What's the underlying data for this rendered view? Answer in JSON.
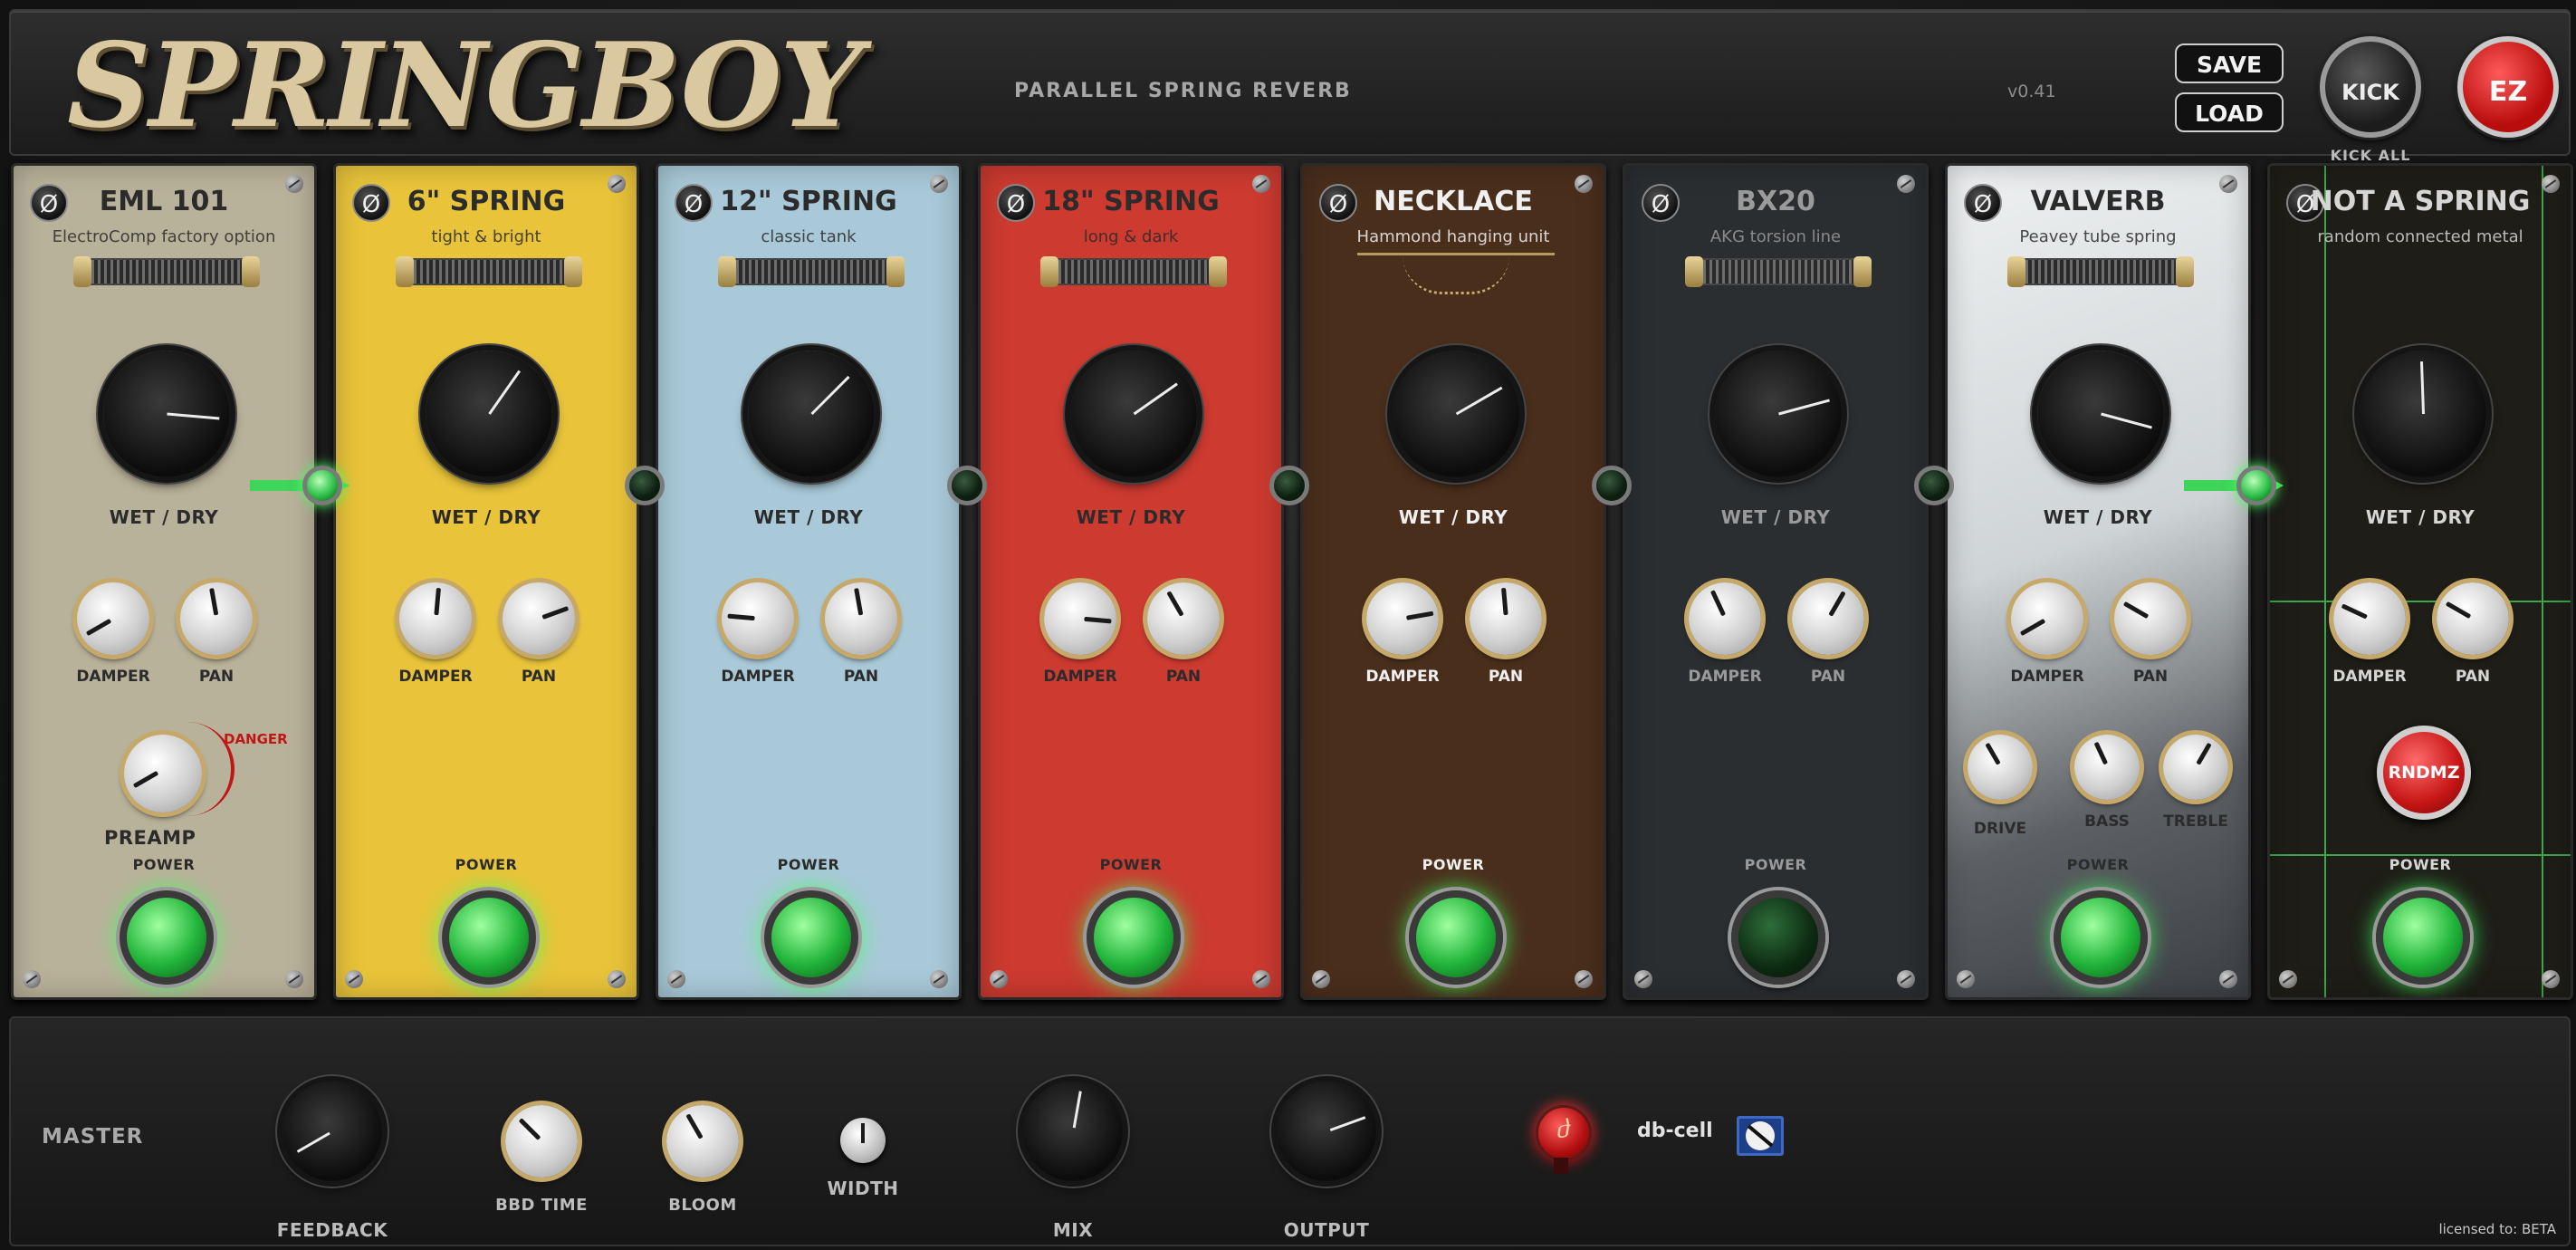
{
  "header": {
    "title": "SPRINGBOY",
    "subtitle": "PARALLEL SPRING REVERB",
    "version": "v0.41",
    "save_label": "SAVE",
    "load_label": "LOAD",
    "kick_label": "KICK",
    "kick_all_label": "KICK ALL",
    "ez_label": "EZ"
  },
  "labels": {
    "phase_symbol": "Ø",
    "wet_dry": "WET / DRY",
    "damper": "DAMPER",
    "pan": "PAN",
    "power": "POWER",
    "preamp": "PREAMP",
    "danger": "DANGER",
    "drive": "DRIVE",
    "bass": "BASS",
    "treble": "TREBLE",
    "rndmz": "RNDMZ"
  },
  "modules": [
    {
      "name": "EML 101",
      "desc": "ElectroComp factory option",
      "power": true,
      "wet_dry_deg": 95,
      "damper_deg": -120,
      "pan_deg": -10,
      "bg": "#b9b29a",
      "text": "#2b2b2b"
    },
    {
      "name": "6\" SPRING",
      "desc": "tight & bright",
      "power": true,
      "wet_dry_deg": 35,
      "damper_deg": 5,
      "pan_deg": 70,
      "bg": "#e9c43a",
      "text": "#2b2b2b"
    },
    {
      "name": "12\" SPRING",
      "desc": "classic tank",
      "power": true,
      "wet_dry_deg": 45,
      "damper_deg": -85,
      "pan_deg": -10,
      "bg": "#a9c9d8",
      "text": "#2b2b2b"
    },
    {
      "name": "18\" SPRING",
      "desc": "long & dark",
      "power": true,
      "wet_dry_deg": 55,
      "damper_deg": 95,
      "pan_deg": -30,
      "bg": "#cc3a30",
      "text": "#2b2b2b"
    },
    {
      "name": "NECKLACE",
      "desc": "Hammond hanging unit",
      "power": true,
      "wet_dry_deg": 60,
      "damper_deg": 80,
      "pan_deg": -5,
      "bg": "#4a2e1c",
      "text": "#f0f0f0"
    },
    {
      "name": "BX20",
      "desc": "AKG torsion line",
      "power": false,
      "wet_dry_deg": 75,
      "damper_deg": -25,
      "pan_deg": 30,
      "bg": "#2b2e31",
      "text": "#9a9a9a"
    },
    {
      "name": "VALVERB",
      "desc": "Peavey tube spring",
      "power": true,
      "wet_dry_deg": 105,
      "damper_deg": -120,
      "pan_deg": -60,
      "bg": "#d6dadb",
      "text": "#2b2b2b"
    },
    {
      "name": "NOT A SPRING",
      "desc": "random connected metal",
      "power": true,
      "wet_dry_deg": -2,
      "damper_deg": -65,
      "pan_deg": -60,
      "bg": "#1e1d17",
      "text": "#d6d6d6"
    }
  ],
  "valverb_extra": {
    "drive_deg": -30,
    "bass_deg": -25,
    "treble_deg": 30
  },
  "preamp_deg": -120,
  "connectors": [
    true,
    false,
    false,
    false,
    false,
    false,
    true
  ],
  "master": {
    "title": "MASTER",
    "feedback_label": "FEEDBACK",
    "bbd_time_label": "BBD TIME",
    "bloom_label": "BLOOM",
    "width_label": "WIDTH",
    "mix_label": "MIX",
    "output_label": "OUTPUT",
    "dbcell_label": "db-cell",
    "dbcell_icon": "ⴛ",
    "feedback_deg": -120,
    "bbd_time_deg": -45,
    "bloom_deg": -30,
    "width_deg": 0,
    "mix_deg": 10,
    "output_deg": 70
  },
  "footer": {
    "licensed": "licensed to: BETA"
  }
}
